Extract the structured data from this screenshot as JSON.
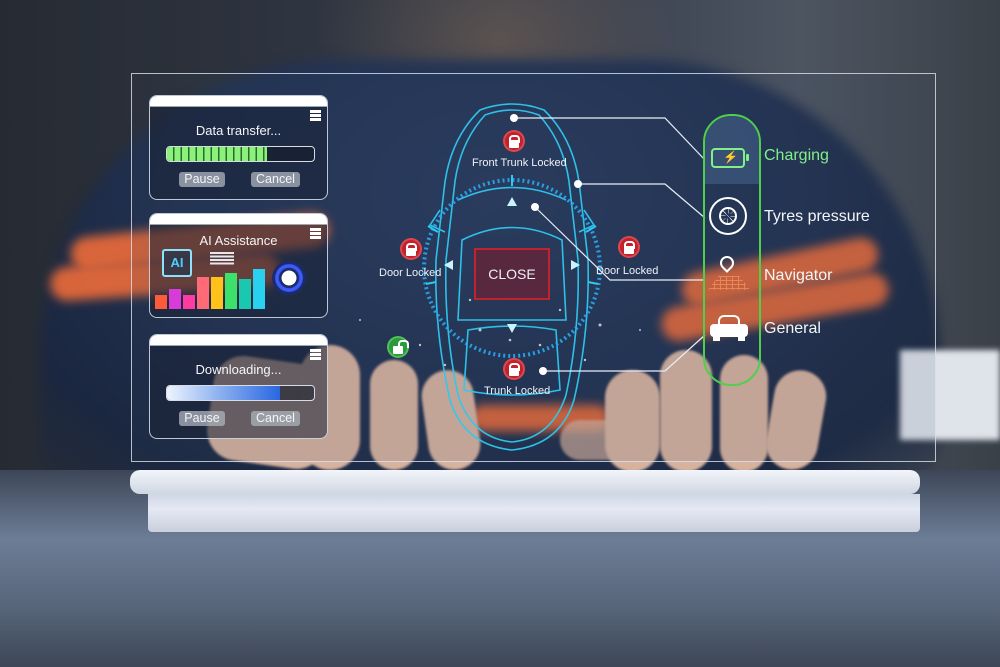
{
  "panels": {
    "data_transfer": {
      "title": "Data transfer...",
      "progress_percent": 68,
      "pause_label": "Pause",
      "cancel_label": "Cancel"
    },
    "ai_assistance": {
      "title": "AI Assistance",
      "chip_label": "AI"
    },
    "downloading": {
      "title": "Downloading...",
      "progress_percent": 77,
      "pause_label": "Pause",
      "cancel_label": "Cancel"
    }
  },
  "car_status": {
    "front_trunk": "Front Trunk Locked",
    "door_left": "Door Locked",
    "door_right": "Door Locked",
    "trunk": "Trunk Locked",
    "close_button": "CLOSE"
  },
  "menu": {
    "items": [
      {
        "label": "Charging",
        "icon": "battery-charging-icon",
        "active": true
      },
      {
        "label": "Tyres pressure",
        "icon": "tyre-icon",
        "active": false
      },
      {
        "label": "Navigator",
        "icon": "location-pin-icon",
        "active": false
      },
      {
        "label": "General",
        "icon": "car-icon",
        "active": false
      }
    ]
  },
  "colors": {
    "accent_green": "#4ed04a",
    "active_text": "#7ff08a",
    "car_outline": "#2ec8f0",
    "lock_red": "#c2222c",
    "unlock_green": "#2a9a3a",
    "download_blue": "#2a66e0"
  }
}
